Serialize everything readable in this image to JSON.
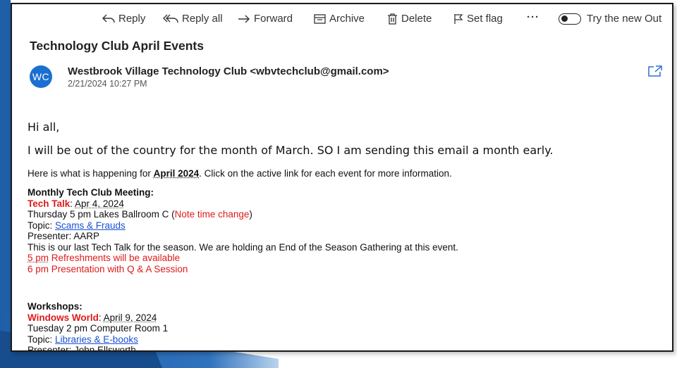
{
  "toolbar": {
    "reply": "Reply",
    "reply_all": "Reply all",
    "forward": "Forward",
    "archive": "Archive",
    "delete": "Delete",
    "set_flag": "Set flag",
    "more": "···",
    "try_new": "Try the new Out"
  },
  "email": {
    "subject": "Technology Club April Events",
    "avatar_initials": "WC",
    "sender": "Westbrook Village Technology Club <wbvtechclub@gmail.com>",
    "date": "2/21/2024 10:27 PM",
    "greeting": "Hi all,",
    "intro": "I will be out of the country for the month of March.  SO I am sending this email a month early.",
    "info_prefix": "Here is what is happening for ",
    "info_bold": "April 2024",
    "info_suffix": ".  Click on the active link for each event for more information."
  },
  "meeting": {
    "heading": "Monthly Tech Club Meeting:",
    "event_label": "Tech Talk",
    "event_sep": ":  ",
    "event_date": "Apr 4, 2024",
    "when": "Thursday  5 pm   Lakes Ballroom C  (",
    "note": "Note time change",
    "when_close": ")",
    "topic_label": "Topic:  ",
    "topic_link": "Scams & Frauds",
    "presenter": "Presenter:  AARP",
    "description": "This is our last Tech Talk for the season.  We are holding an End of the Season Gathering at this event.",
    "sched1_time": "5 pm",
    "sched1_text": "   Refreshments will be available",
    "sched2": "6 pm   Presentation with Q & A Session"
  },
  "workshops": {
    "heading": "Workshops:",
    "event_label": "Windows World",
    "event_sep": ":   ",
    "event_date": "April 9, 2024",
    "when": "Tuesday  2 pm   Computer Room 1",
    "topic_label": "Topic:  ",
    "topic_link": "Libraries & E-books",
    "presenter": "Presenter:  John Ellsworth"
  },
  "colors": {
    "accent_red": "#e01a1a",
    "link_blue": "#1a4fd6",
    "avatar_blue": "#1a6fd1",
    "decor_blue": "#1f5fa8"
  }
}
